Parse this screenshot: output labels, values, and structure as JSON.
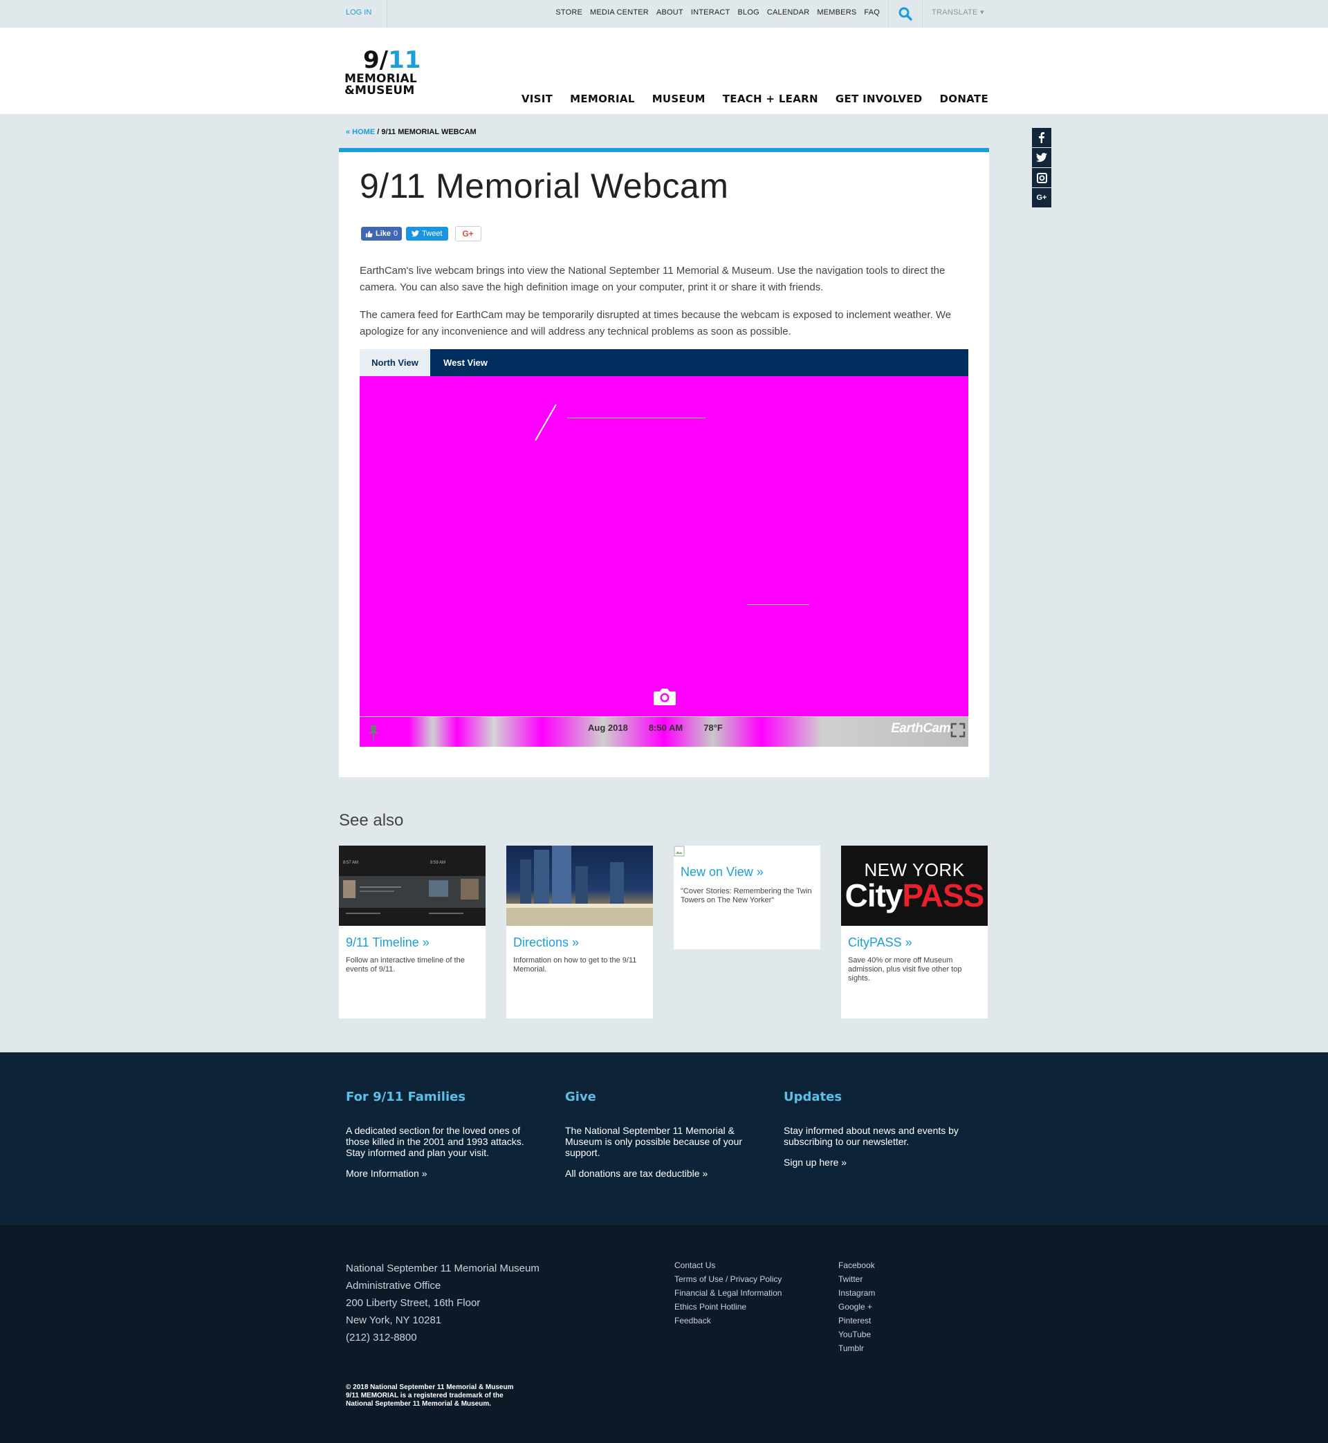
{
  "utility": {
    "login": "LOG IN",
    "links": [
      "STORE",
      "MEDIA CENTER",
      "ABOUT",
      "INTERACT",
      "BLOG",
      "CALENDAR",
      "MEMBERS",
      "FAQ"
    ],
    "translate": "TRANSLATE ▾"
  },
  "logo": {
    "nine": "9/",
    "eleven": "11",
    "line1": "MEMORIAL",
    "line2": "&MUSEUM"
  },
  "nav": [
    "VISIT",
    "MEMORIAL",
    "MUSEUM",
    "TEACH + LEARN",
    "GET INVOLVED",
    "DONATE"
  ],
  "breadcrumb": {
    "home": "« HOME",
    "separator": " / ",
    "current": "9/11 MEMORIAL WEBCAM"
  },
  "social_rail": [
    "f",
    "t",
    "i",
    "G+"
  ],
  "page": {
    "title": "9/11 Memorial Webcam",
    "share": {
      "like": "Like",
      "like_count": "0",
      "tweet": "Tweet",
      "gplus": "G+"
    },
    "paragraphs": [
      "EarthCam's live webcam brings into view the National September 11 Memorial & Museum. Use the navigation tools to direct the camera. You can also save the high definition image on your computer, print it or share it with friends.",
      "The camera feed for EarthCam may be temporarily disrupted at times because the webcam is exposed to inclement weather. We apologize for any inconvenience and will address any technical problems as soon as possible."
    ],
    "tabs": [
      "North View",
      "West View"
    ],
    "active_tab": "North View",
    "webcam": {
      "date": "Aug 2018",
      "time": "8:50 AM",
      "temp": "78°F",
      "brand": "EarthCam"
    }
  },
  "see_also": {
    "title": "See also",
    "tiles": [
      {
        "title": "9/11 Timeline »",
        "desc": "Follow an interactive timeline of the events of 9/11."
      },
      {
        "title": "Directions »",
        "desc": "Information on how to get to the 9/11 Memorial."
      },
      {
        "title": "New on View »",
        "desc": "\"Cover Stories: Remembering the Twin Towers on The New Yorker\""
      },
      {
        "title": "CityPASS »",
        "desc": "Save 40% or more off Museum admission, plus visit five other top sights."
      }
    ],
    "timeline_img": {
      "time_a": "8:57 AM",
      "time_b": "8:59 AM"
    },
    "citypass_img": {
      "line1": "NEW YORK",
      "city": "City",
      "pass": "PASS"
    }
  },
  "footer": {
    "columns": [
      {
        "title": "For 9/11 Families",
        "text": "A dedicated section for the loved ones of those killed in the 2001 and 1993 attacks. Stay informed and plan your visit.",
        "link": "More Information »"
      },
      {
        "title": "Give",
        "text": "The National September 11 Memorial & Museum is only possible because of your support.",
        "link": "All donations are tax deductible »"
      },
      {
        "title": "Updates",
        "text": "Stay informed about news and events by subscribing to our newsletter.",
        "link": "Sign up here »"
      }
    ],
    "address": [
      "National September 11 Memorial Museum",
      "Administrative Office",
      "200 Liberty Street, 16th Floor",
      "New York, NY 10281",
      "(212) 312-8800"
    ],
    "links": [
      "Contact Us",
      "Terms of Use / Privacy Policy",
      "Financial & Legal Information",
      "Ethics Point Hotline",
      "Feedback"
    ],
    "social": [
      "Facebook",
      "Twitter",
      "Instagram",
      "Google +",
      "Pinterest",
      "YouTube",
      "Tumblr"
    ],
    "copyright": [
      "© 2018 National September 11 Memorial & Museum",
      "9/11 MEMORIAL is a registered trademark of the",
      "National September 11 Memorial & Museum."
    ]
  },
  "colors": {
    "accent": "#1a9ed9",
    "navy": "#002f5f",
    "footer_top": "#0d2438",
    "footer_bottom": "#0c1a28",
    "webcam_placeholder": "#ff00ff"
  }
}
